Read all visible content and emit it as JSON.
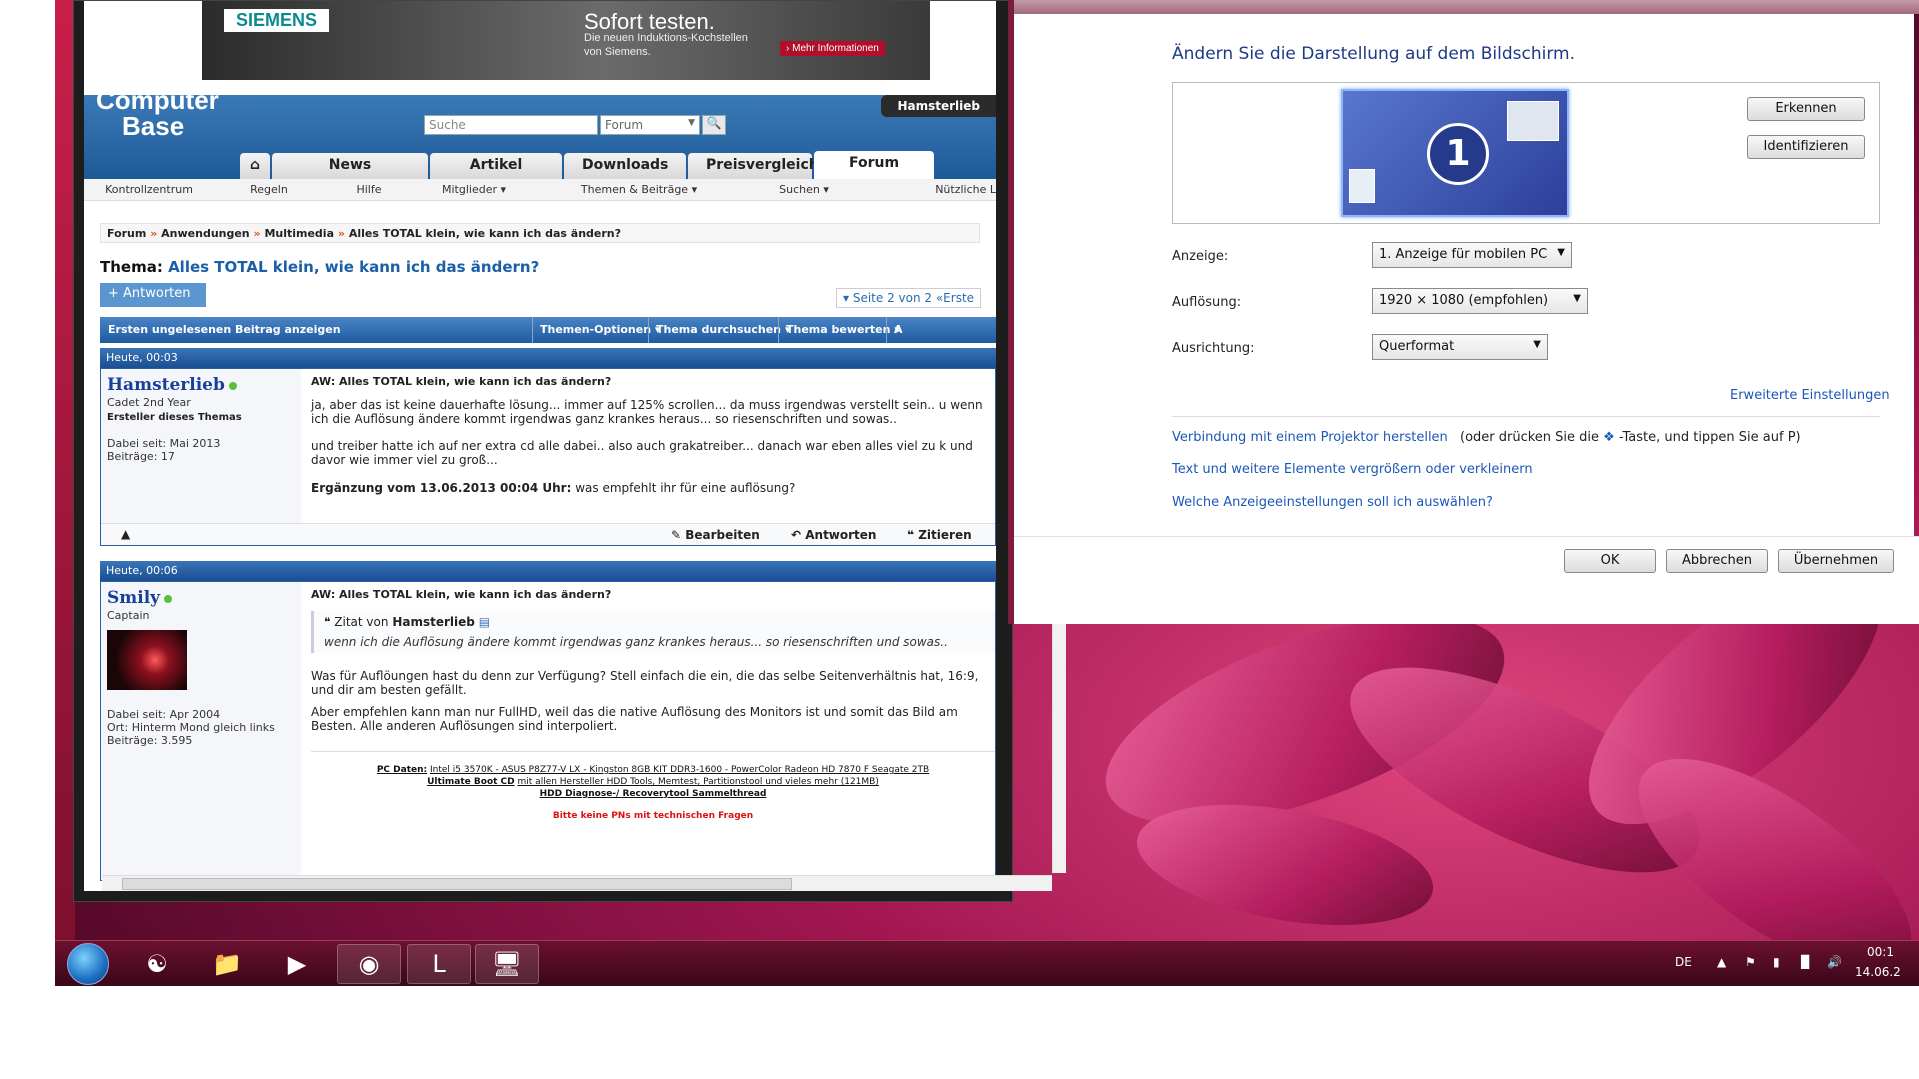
{
  "ad": {
    "brand": "SIEMENS",
    "headline": "Sofort testen.",
    "sub": "Die neuen Induktions-Kochstellen von Siemens.",
    "button": "› Mehr Informationen"
  },
  "site": {
    "logo_line1": "Computer",
    "logo_line2": "Base",
    "user": "Hamsterlieb",
    "search_placeholder": "Suche",
    "search_scope": "Forum",
    "tabs": [
      "News",
      "Artikel",
      "Downloads",
      "Preisvergleich",
      "Forum"
    ],
    "subnav": [
      "Kontrollzentrum",
      "Regeln",
      "Hilfe",
      "Mitglieder ▾",
      "Themen & Beiträge ▾",
      "Suchen ▾",
      "Nützliche L"
    ]
  },
  "thread": {
    "breadcrumb": [
      "Forum",
      "Anwendungen",
      "Multimedia",
      "Alles TOTAL klein, wie kann ich das ändern?"
    ],
    "label": "Thema:",
    "title": "Alles TOTAL klein, wie kann ich das ändern?",
    "reply_button": "+ Antworten",
    "pagenav": "▾ Seite 2 von 2  «Erste",
    "bar": {
      "first_unread": "Ersten ungelesenen Beitrag anzeigen",
      "options": "Themen-Optionen ▾",
      "search": "Thema durchsuchen ▾",
      "rate": "Thema bewerten ▾",
      "more": "A"
    }
  },
  "posts": [
    {
      "time": "Heute, 00:03",
      "user": "Hamsterlieb",
      "rank": "Cadet 2nd Year",
      "badge": "Ersteller dieses Themas",
      "joined": "Dabei seit: Mai 2013",
      "posts": "Beiträge: 17",
      "title": "AW: Alles TOTAL klein, wie kann ich das ändern?",
      "p1": "ja, aber das ist keine dauerhafte lösung... immer auf 125% scrollen... da muss irgendwas verstellt sein.. u wenn ich die Auflösung ändere kommt irgendwas ganz krankes heraus... so riesenschriften und sowas..",
      "p2": "und treiber hatte ich auf ner extra cd alle dabei.. also auch grakatreiber... danach war eben alles viel zu k und davor wie immer viel zu groß...",
      "supp_label": "Ergänzung vom 13.06.2013 00:04 Uhr:",
      "supp_text": "was empfehlt ihr für eine auflösung?",
      "actions": [
        "Bearbeiten",
        "Antworten",
        "Zitieren"
      ]
    },
    {
      "time": "Heute, 00:06",
      "user": "Smily",
      "rank": "Captain",
      "joined": "Dabei seit: Apr 2004",
      "location": "Ort: Hinterm Mond gleich links",
      "posts": "Beiträge: 3.595",
      "title": "AW: Alles TOTAL klein, wie kann ich das ändern?",
      "quote_from": "Zitat von",
      "quote_user": "Hamsterlieb",
      "quote_text": "wenn ich die Auflösung ändere kommt irgendwas ganz krankes heraus... so riesenschriften und sowas..",
      "p1": "Was für Auflöungen hast du denn zur Verfügung? Stell einfach die ein, die das selbe Seitenverhältnis hat, 16:9, und dir am besten gefällt.",
      "p2": "Aber empfehlen kann man nur FullHD, weil das die native Auflösung des Monitors ist und somit das Bild am Besten. Alle anderen Auflösungen sind interpoliert.",
      "sig1_label": "PC Daten:",
      "sig1": "Intel i5 3570K - ASUS P8Z77-V LX - Kingston 8GB KIT DDR3-1600 - PowerColor Radeon HD 7870 F Seagate 2TB",
      "sig2_label": "Ultimate Boot CD",
      "sig2": "mit allen Hersteller HDD Tools, Memtest, Partitionstool und vieles mehr (121MB)",
      "sig3": "HDD Diagnose-/ Recoverytool Sammelthread",
      "sig4": "Bitte keine PNs mit technischen Fragen"
    }
  ],
  "dialog": {
    "title": "Ändern Sie die Darstellung auf dem Bildschirm.",
    "monitor_number": "1",
    "detect": "Erkennen",
    "identify": "Identifizieren",
    "display_label": "Anzeige:",
    "display_value": "1. Anzeige für mobilen PC",
    "resolution_label": "Auflösung:",
    "resolution_value": "1920 × 1080 (empfohlen)",
    "orientation_label": "Ausrichtung:",
    "orientation_value": "Querformat",
    "advanced": "Erweiterte Einstellungen",
    "projector_link": "Verbindung mit einem Projektor herstellen",
    "projector_text": "(oder drücken Sie die",
    "projector_text2": "-Taste, und tippen Sie auf P)",
    "text_link": "Text und weitere Elemente vergrößern oder verkleinern",
    "which_link": "Welche Anzeigeeinstellungen soll ich auswählen?",
    "ok": "OK",
    "cancel": "Abbrechen",
    "apply": "Übernehmen"
  },
  "taskbar": {
    "lang": "DE",
    "time": "00:1",
    "date": "14.06.2"
  }
}
